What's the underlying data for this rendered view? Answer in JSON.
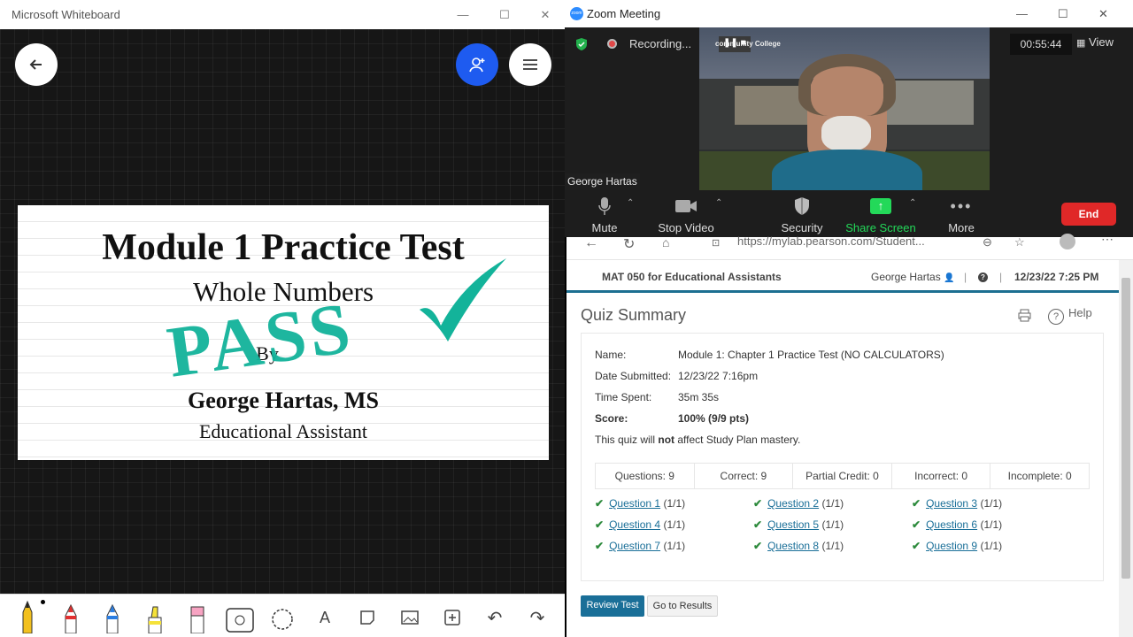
{
  "whiteboard": {
    "title": "Microsoft Whiteboard",
    "slide": {
      "title": "Module 1 Practice Test",
      "subtitle": "Whole Numbers",
      "stamp": "PASS",
      "by": "By",
      "author": "George Hartas, MS",
      "role": "Educational Assistant"
    },
    "tools": [
      "pen-black",
      "pen-red",
      "pen-blue",
      "highlighter-yellow",
      "eraser-pink",
      "ruler",
      "lasso",
      "text",
      "shape",
      "image",
      "insert",
      "undo",
      "redo"
    ]
  },
  "zoom": {
    "title": "Zoom Meeting",
    "recording_label": "Recording...",
    "timer": "00:55:44",
    "view_label": "View",
    "participant_name": "George Hartas",
    "controls": {
      "mute": "Mute",
      "stop_video": "Stop Video",
      "security": "Security",
      "share_screen": "Share Screen",
      "more": "More",
      "end": "End"
    },
    "accent": "#2d8cff",
    "share_color": "#23d959",
    "end_color": "#e02828"
  },
  "browser": {
    "url": "https://mylab.pearson.com/Student...",
    "course": "MAT 050 for Educational Assistants",
    "user": "George Hartas",
    "datetime": "12/23/22 7:25 PM",
    "page_title": "Quiz Summary",
    "help_label": "Help",
    "details": {
      "name_label": "Name:",
      "name_value": "Module 1: Chapter 1 Practice Test (NO CALCULATORS)",
      "date_label": "Date Submitted:",
      "date_value": "12/23/22 7:16pm",
      "time_label": "Time Spent:",
      "time_value": "35m 35s",
      "score_label": "Score:",
      "score_value": "100% (9/9 pts)",
      "note_prefix": "This quiz will ",
      "note_bold": "not",
      "note_suffix": " affect Study Plan mastery."
    },
    "stats": [
      "Questions: 9",
      "Correct: 9",
      "Partial Credit: 0",
      "Incorrect: 0",
      "Incomplete: 0"
    ],
    "questions": [
      {
        "label": "Question 1",
        "score": "(1/1)"
      },
      {
        "label": "Question 2",
        "score": "(1/1)"
      },
      {
        "label": "Question 3",
        "score": "(1/1)"
      },
      {
        "label": "Question 4",
        "score": "(1/1)"
      },
      {
        "label": "Question 5",
        "score": "(1/1)"
      },
      {
        "label": "Question 6",
        "score": "(1/1)"
      },
      {
        "label": "Question 7",
        "score": "(1/1)"
      },
      {
        "label": "Question 8",
        "score": "(1/1)"
      },
      {
        "label": "Question 9",
        "score": "(1/1)"
      }
    ],
    "review_button": "Review Test",
    "results_button": "Go to Results",
    "link_color": "#1a6f98"
  }
}
